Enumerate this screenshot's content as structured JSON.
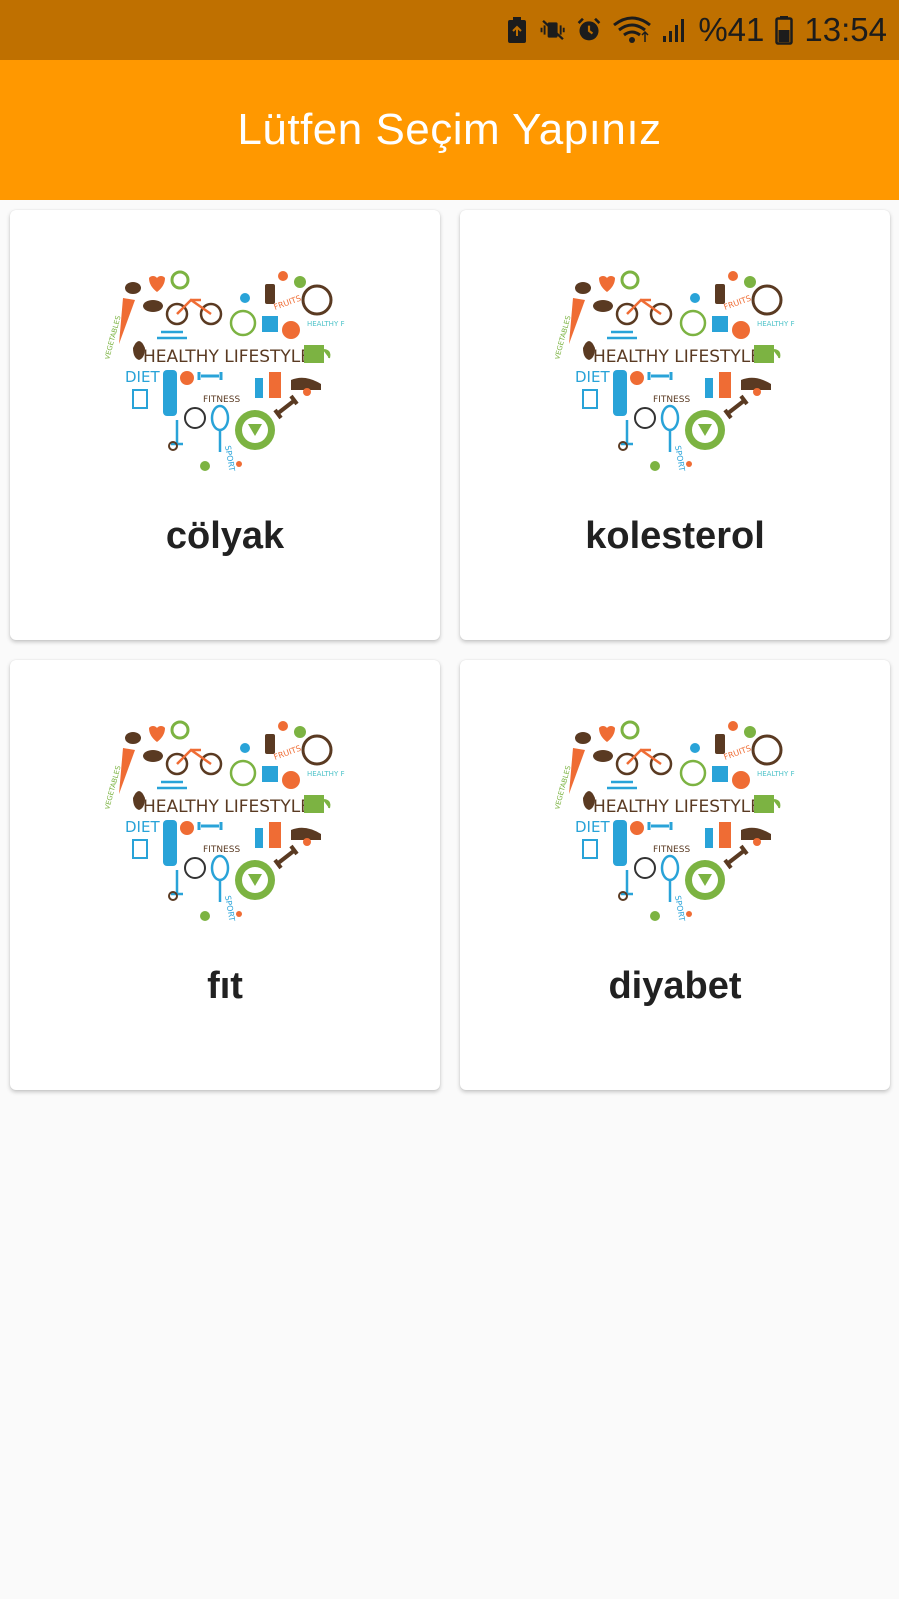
{
  "status_bar": {
    "battery_percent": "%41",
    "time": "13:54",
    "icons": [
      "battery-saver-icon",
      "vibrate-mute-icon",
      "alarm-icon",
      "wifi-icon",
      "signal-icon",
      "battery-icon"
    ]
  },
  "app_bar": {
    "title": "Lütfen Seçim Yapınız",
    "color": "#ff9800"
  },
  "cards": [
    {
      "label": "cölyak",
      "image_text": "HEALTHY LIFESTYLE",
      "image_sub1": "DIET",
      "image_sub2": "FITNESS",
      "image_sub3": "SPORT",
      "image_sub4": "VEGETABLES",
      "image_sub5": "FRUITS",
      "image_sub6": "HEALTHY FOOD"
    },
    {
      "label": "kolesterol",
      "image_text": "HEALTHY LIFESTYLE",
      "image_sub1": "DIET",
      "image_sub2": "FITNESS",
      "image_sub3": "SPORT",
      "image_sub4": "VEGETABLES",
      "image_sub5": "FRUITS",
      "image_sub6": "HEALTHY FOOD"
    },
    {
      "label": "fıt",
      "image_text": "HEALTHY LIFESTYLE",
      "image_sub1": "DIET",
      "image_sub2": "FITNESS",
      "image_sub3": "SPORT",
      "image_sub4": "VEGETABLES",
      "image_sub5": "FRUITS",
      "image_sub6": "HEALTHY FOOD"
    },
    {
      "label": "diyabet",
      "image_text": "HEALTHY LIFESTYLE",
      "image_sub1": "DIET",
      "image_sub2": "FITNESS",
      "image_sub3": "SPORT",
      "image_sub4": "VEGETABLES",
      "image_sub5": "FRUITS",
      "image_sub6": "HEALTHY FOOD"
    }
  ]
}
